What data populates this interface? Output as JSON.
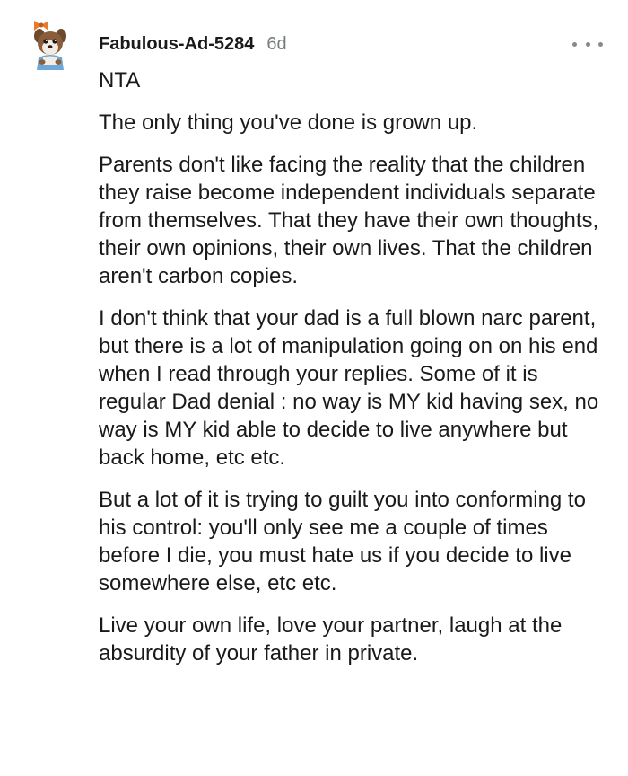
{
  "comment": {
    "username": "Fabulous-Ad-5284",
    "timestamp": "6d",
    "more_icon": "more-horizontal-icon",
    "avatar_icon": "user-avatar-icon",
    "paragraphs": [
      "NTA",
      "The only thing you've done is grown up.",
      "Parents don't like facing the reality that the children they raise become independent individuals separate from themselves. That they have their own thoughts, their own opinions, their own lives. That the children aren't carbon copies.",
      "I don't think that your dad is a full blown narc parent, but there is a lot of manipulation going on on his end when I read through your replies. Some of it is regular Dad denial : no way is MY kid having sex, no way is MY kid able to decide to live anywhere but back home, etc etc.",
      "But a lot of it is trying to guilt you into conforming to his control: you'll only see me a couple of times before I die, you must hate us if you decide to live somewhere else, etc etc.",
      "Live your own life, love your partner, laugh at the absurdity of your father in private."
    ]
  },
  "colors": {
    "text": "#1a1a1b",
    "meta": "#787c7e",
    "icon": "#878a8c",
    "background": "#ffffff"
  }
}
